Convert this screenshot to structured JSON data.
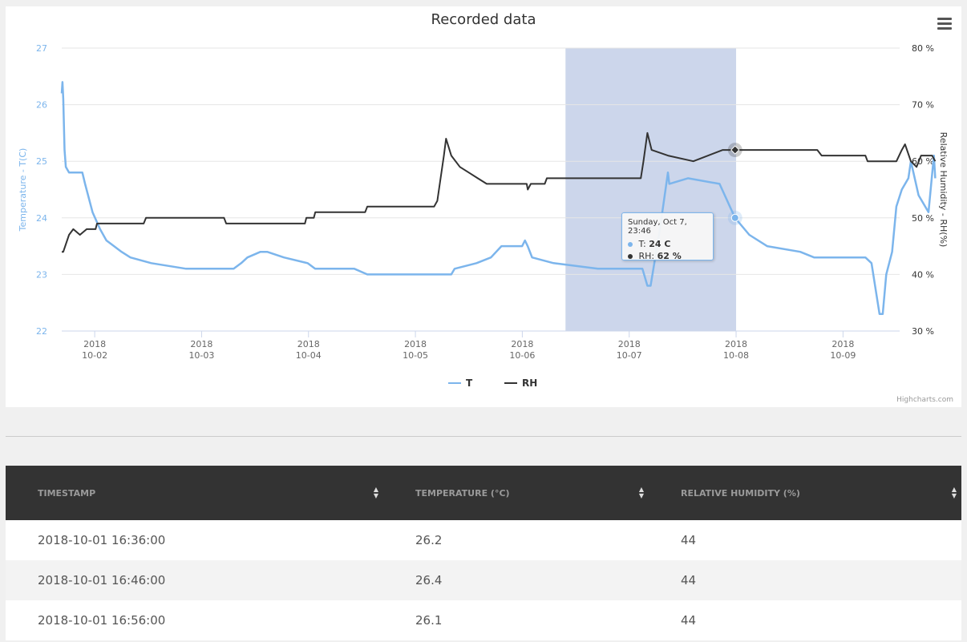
{
  "chart_data": {
    "type": "line",
    "title": "Recorded data",
    "y_left_label": "Temperature - T(C)",
    "y_right_label": "Relative Humidity - RH(%)",
    "y_left_range": [
      22,
      27
    ],
    "y_left_ticks": [
      "22",
      "23",
      "24",
      "25",
      "26",
      "27"
    ],
    "y_right_range": [
      30,
      80
    ],
    "y_right_ticks": [
      "30 %",
      "40 %",
      "50 %",
      "60 %",
      "70 %",
      "80 %"
    ],
    "x_ticks": [
      {
        "day": 2,
        "top": "2018",
        "bottom": "10-02"
      },
      {
        "day": 3,
        "top": "2018",
        "bottom": "10-03"
      },
      {
        "day": 4,
        "top": "2018",
        "bottom": "10-04"
      },
      {
        "day": 5,
        "top": "2018",
        "bottom": "10-05"
      },
      {
        "day": 6,
        "top": "2018",
        "bottom": "10-06"
      },
      {
        "day": 7,
        "top": "2018",
        "bottom": "10-07"
      },
      {
        "day": 8,
        "top": "2018",
        "bottom": "10-08"
      },
      {
        "day": 9,
        "top": "2018",
        "bottom": "10-09"
      }
    ],
    "x_range": [
      "2018-10-01T16:36",
      "2018-10-09T12:43"
    ],
    "highlight_range": [
      "2018-10-06T09:42",
      "2018-10-08T00:00"
    ],
    "series": [
      {
        "name": "T",
        "color": "#7cb5ec",
        "points": [
          [
            "2018-10-01T16:36",
            26.2
          ],
          [
            "2018-10-01T16:46",
            26.4
          ],
          [
            "2018-10-01T16:56",
            26.1
          ],
          [
            "2018-10-01T17:14",
            25.2
          ],
          [
            "2018-10-01T17:31",
            24.9
          ],
          [
            "2018-10-01T18:14",
            24.8
          ],
          [
            "2018-10-01T21:14",
            24.8
          ],
          [
            "2018-10-01T21:50",
            24.6
          ],
          [
            "2018-10-01T23:31",
            24.1
          ],
          [
            "2018-10-02T01:12",
            23.8
          ],
          [
            "2018-10-02T02:38",
            23.6
          ],
          [
            "2018-10-02T04:20",
            23.5
          ],
          [
            "2018-10-02T06:02",
            23.4
          ],
          [
            "2018-10-02T08:01",
            23.3
          ],
          [
            "2018-10-02T12:41",
            23.2
          ],
          [
            "2018-10-02T20:31",
            23.1
          ],
          [
            "2018-10-03T07:12",
            23.1
          ],
          [
            "2018-10-03T08:53",
            23.2
          ],
          [
            "2018-10-03T10:17",
            23.3
          ],
          [
            "2018-10-03T13:12",
            23.4
          ],
          [
            "2018-10-03T14:43",
            23.4
          ],
          [
            "2018-10-03T18:29",
            23.3
          ],
          [
            "2018-10-03T23:48",
            23.2
          ],
          [
            "2018-10-04T01:29",
            23.1
          ],
          [
            "2018-10-04T10:17",
            23.1
          ],
          [
            "2018-10-04T13:12",
            23.0
          ],
          [
            "2018-10-05T08:03",
            23.0
          ],
          [
            "2018-10-05T08:48",
            23.1
          ],
          [
            "2018-10-05T13:43",
            23.2
          ],
          [
            "2018-10-05T16:58",
            23.3
          ],
          [
            "2018-10-05T19:19",
            23.5
          ],
          [
            "2018-10-05T23:58",
            23.5
          ],
          [
            "2018-10-06T00:36",
            23.6
          ],
          [
            "2018-10-06T01:12",
            23.5
          ],
          [
            "2018-10-06T02:12",
            23.3
          ],
          [
            "2018-10-06T07:00",
            23.2
          ],
          [
            "2018-10-06T16:58",
            23.1
          ],
          [
            "2018-10-07T02:58",
            23.1
          ],
          [
            "2018-10-07T04:05",
            22.8
          ],
          [
            "2018-10-07T04:48",
            22.8
          ],
          [
            "2018-10-07T06:53",
            23.8
          ],
          [
            "2018-10-07T08:41",
            24.8
          ],
          [
            "2018-10-07T09:00",
            24.6
          ],
          [
            "2018-10-07T13:12",
            24.7
          ],
          [
            "2018-10-07T20:17",
            24.6
          ],
          [
            "2018-10-07T23:46",
            24.0
          ],
          [
            "2018-10-08T02:58",
            23.7
          ],
          [
            "2018-10-08T06:58",
            23.5
          ],
          [
            "2018-10-08T14:24",
            23.4
          ],
          [
            "2018-10-08T17:31",
            23.3
          ],
          [
            "2018-10-09T05:02",
            23.3
          ],
          [
            "2018-10-09T06:24",
            23.2
          ],
          [
            "2018-10-09T08:12",
            22.3
          ],
          [
            "2018-10-09T08:55",
            22.3
          ],
          [
            "2018-10-09T09:43",
            23.0
          ],
          [
            "2018-10-09T11:02",
            23.4
          ],
          [
            "2018-10-09T11:59",
            24.2
          ],
          [
            "2018-10-09T13:12",
            24.5
          ],
          [
            "2018-10-09T14:41",
            24.7
          ],
          [
            "2018-10-09T15:14",
            25.0
          ],
          [
            "2018-10-09T16:58",
            24.4
          ],
          [
            "2018-10-09T19:12",
            24.1
          ],
          [
            "2018-10-09T20:24",
            25.1
          ],
          [
            "2018-10-09T20:43",
            24.7
          ]
        ]
      },
      {
        "name": "RH",
        "color": "#333333",
        "points": [
          [
            "2018-10-01T16:36",
            44
          ],
          [
            "2018-10-01T16:56",
            44
          ],
          [
            "2018-10-01T18:14",
            47
          ],
          [
            "2018-10-01T19:12",
            48
          ],
          [
            "2018-10-01T20:41",
            47
          ],
          [
            "2018-10-01T22:12",
            48
          ],
          [
            "2018-10-02T00:12",
            48
          ],
          [
            "2018-10-02T00:31",
            49
          ],
          [
            "2018-10-02T11:00",
            49
          ],
          [
            "2018-10-02T11:31",
            50
          ],
          [
            "2018-10-03T05:02",
            50
          ],
          [
            "2018-10-03T05:31",
            49
          ],
          [
            "2018-10-03T23:12",
            49
          ],
          [
            "2018-10-03T23:31",
            50
          ],
          [
            "2018-10-04T01:12",
            50
          ],
          [
            "2018-10-04T01:31",
            51
          ],
          [
            "2018-10-04T12:43",
            51
          ],
          [
            "2018-10-04T13:12",
            52
          ],
          [
            "2018-10-05T04:12",
            52
          ],
          [
            "2018-10-05T04:55",
            53
          ],
          [
            "2018-10-05T06:24",
            61
          ],
          [
            "2018-10-05T06:53",
            64
          ],
          [
            "2018-10-05T08:03",
            61
          ],
          [
            "2018-10-05T10:00",
            59
          ],
          [
            "2018-10-05T12:00",
            58
          ],
          [
            "2018-10-05T14:00",
            57
          ],
          [
            "2018-10-05T16:00",
            56
          ],
          [
            "2018-10-06T01:00",
            56
          ],
          [
            "2018-10-06T01:14",
            55
          ],
          [
            "2018-10-06T01:55",
            56
          ],
          [
            "2018-10-06T05:02",
            56
          ],
          [
            "2018-10-06T05:31",
            57
          ],
          [
            "2018-10-07T02:36",
            57
          ],
          [
            "2018-10-07T03:12",
            60
          ],
          [
            "2018-10-07T04:05",
            65
          ],
          [
            "2018-10-07T05:02",
            62
          ],
          [
            "2018-10-07T08:41",
            61
          ],
          [
            "2018-10-07T14:24",
            60
          ],
          [
            "2018-10-07T21:00",
            62
          ],
          [
            "2018-10-07T22:41",
            62
          ],
          [
            "2018-10-08T04:48",
            62
          ],
          [
            "2018-10-08T18:14",
            62
          ],
          [
            "2018-10-08T19:12",
            61
          ],
          [
            "2018-10-09T05:02",
            61
          ],
          [
            "2018-10-09T05:31",
            60
          ],
          [
            "2018-10-09T12:00",
            60
          ],
          [
            "2018-10-09T13:12",
            62
          ],
          [
            "2018-10-09T13:55",
            63
          ],
          [
            "2018-10-09T15:14",
            60
          ],
          [
            "2018-10-09T16:31",
            59
          ],
          [
            "2018-10-09T17:31",
            61
          ],
          [
            "2018-10-09T20:00",
            61
          ],
          [
            "2018-10-09T20:43",
            60
          ]
        ]
      }
    ],
    "legend": [
      "T",
      "RH"
    ],
    "legend_position": "bottom-center",
    "tooltip": {
      "header": "Sunday, Oct 7, 23:46",
      "t_label": "T:",
      "t_value": "24 C",
      "rh_label": "RH:",
      "rh_value": "62 %",
      "x": "2018-10-07T23:46",
      "t": 24,
      "rh": 62
    },
    "credits": "Highcharts.com"
  },
  "table": {
    "headers": [
      "TIMESTAMP",
      "TEMPERATURE (°C)",
      "RELATIVE HUMIDITY (%)"
    ],
    "rows": [
      [
        "2018-10-01 16:36:00",
        "26.2",
        "44"
      ],
      [
        "2018-10-01 16:46:00",
        "26.4",
        "44"
      ],
      [
        "2018-10-01 16:56:00",
        "26.1",
        "44"
      ]
    ]
  },
  "icons": {
    "menu": "hamburger-menu-icon",
    "sort": "sort-arrows-icon"
  }
}
